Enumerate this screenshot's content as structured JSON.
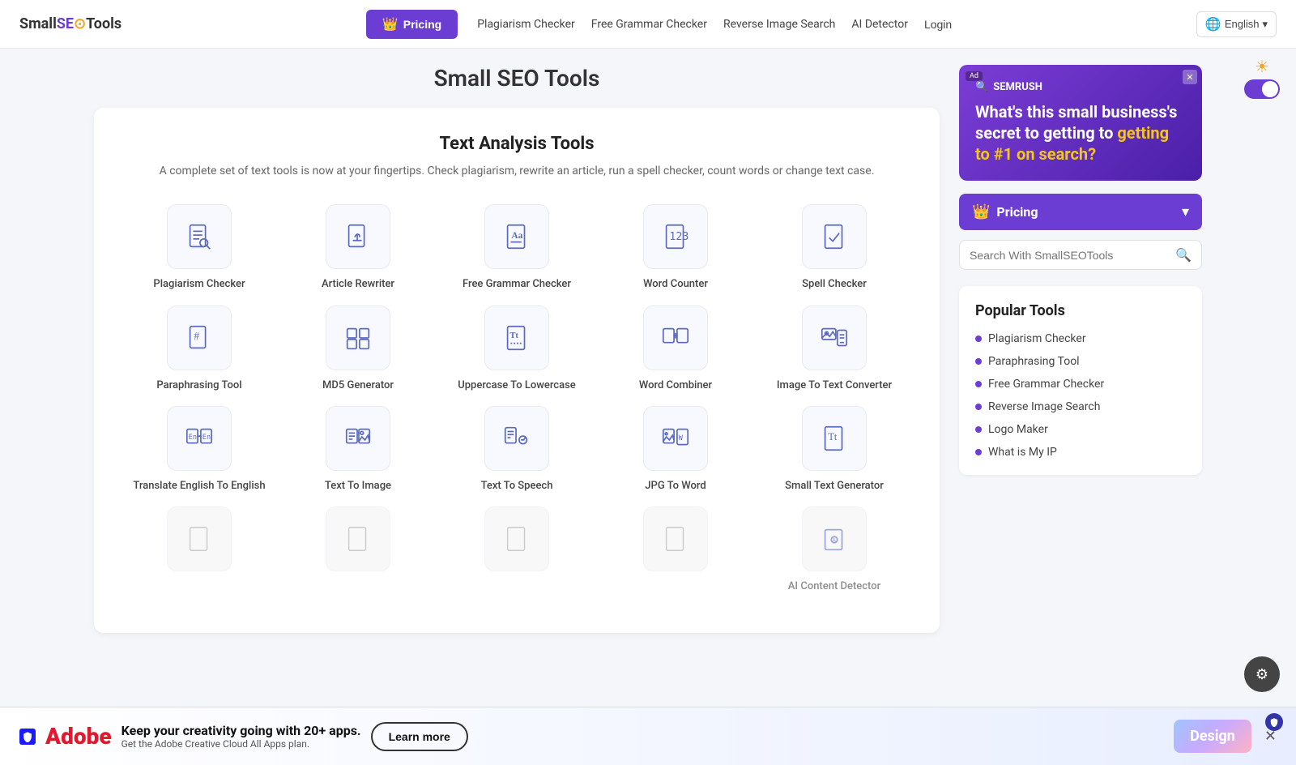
{
  "header": {
    "logo_text": "Small",
    "logo_seo": "SEO",
    "logo_tools": "Tools",
    "pricing_btn": "Pricing",
    "nav_links": [
      {
        "label": "Plagiarism Checker",
        "id": "plagiarism-checker"
      },
      {
        "label": "Free Grammar Checker",
        "id": "free-grammar-checker"
      },
      {
        "label": "Reverse Image Search",
        "id": "reverse-image-search"
      },
      {
        "label": "AI Detector",
        "id": "ai-detector"
      },
      {
        "label": "Login",
        "id": "login"
      }
    ],
    "lang_btn": "English"
  },
  "page": {
    "title": "Small SEO Tools"
  },
  "tools_section": {
    "title": "Text Analysis Tools",
    "description": "A complete set of text tools is now at your fingertips. Check plagiarism, rewrite an article, run a spell checker,\ncount words or change text case.",
    "tools_row1": [
      {
        "id": "plagiarism-checker",
        "label": "Plagiarism Checker"
      },
      {
        "id": "article-rewriter",
        "label": "Article Rewriter"
      },
      {
        "id": "free-grammar-checker",
        "label": "Free Grammar Checker"
      },
      {
        "id": "word-counter",
        "label": "Word Counter"
      },
      {
        "id": "spell-checker",
        "label": "Spell Checker"
      }
    ],
    "tools_row2": [
      {
        "id": "paraphrasing-tool",
        "label": "Paraphrasing Tool"
      },
      {
        "id": "md5-generator",
        "label": "MD5 Generator"
      },
      {
        "id": "uppercase-to-lowercase",
        "label": "Uppercase To Lowercase"
      },
      {
        "id": "word-combiner",
        "label": "Word Combiner"
      },
      {
        "id": "image-to-text-converter",
        "label": "Image To Text Converter"
      }
    ],
    "tools_row3": [
      {
        "id": "translate-english-to-english",
        "label": "Translate English To English"
      },
      {
        "id": "text-to-image",
        "label": "Text To Image"
      },
      {
        "id": "text-to-speech",
        "label": "Text To Speech"
      },
      {
        "id": "jpg-to-word",
        "label": "JPG To Word"
      },
      {
        "id": "small-text-generator",
        "label": "Small Text Generator"
      }
    ],
    "tools_row4": [
      {
        "id": "tool-row4-1",
        "label": ""
      },
      {
        "id": "tool-row4-2",
        "label": ""
      },
      {
        "id": "tool-row4-3",
        "label": ""
      },
      {
        "id": "tool-row4-4",
        "label": ""
      },
      {
        "id": "ai-content-detector",
        "label": "AI Content Detector"
      }
    ]
  },
  "sidebar": {
    "ad_logo": "🔍 SEMRUSH",
    "ad_text1": "What's this small business's secret to",
    "ad_text2": "#1 on search?",
    "pricing_label": "Pricing",
    "search_placeholder": "Search With SmallSEOTools",
    "popular_title": "Popular Tools",
    "popular_tools": [
      "Plagiarism Checker",
      "Paraphrasing Tool",
      "Free Grammar Checker",
      "Reverse Image Search",
      "Logo Maker",
      "What is My IP"
    ]
  },
  "bottom_ad": {
    "brand": "Adobe",
    "headline": "Keep your creativity going with 20+ apps.",
    "subtext": "Get the Adobe Creative Cloud All Apps plan.",
    "cta": "Learn more",
    "design_label": "Design"
  },
  "float_btn": "⚙",
  "toggle_label": "Dark mode"
}
